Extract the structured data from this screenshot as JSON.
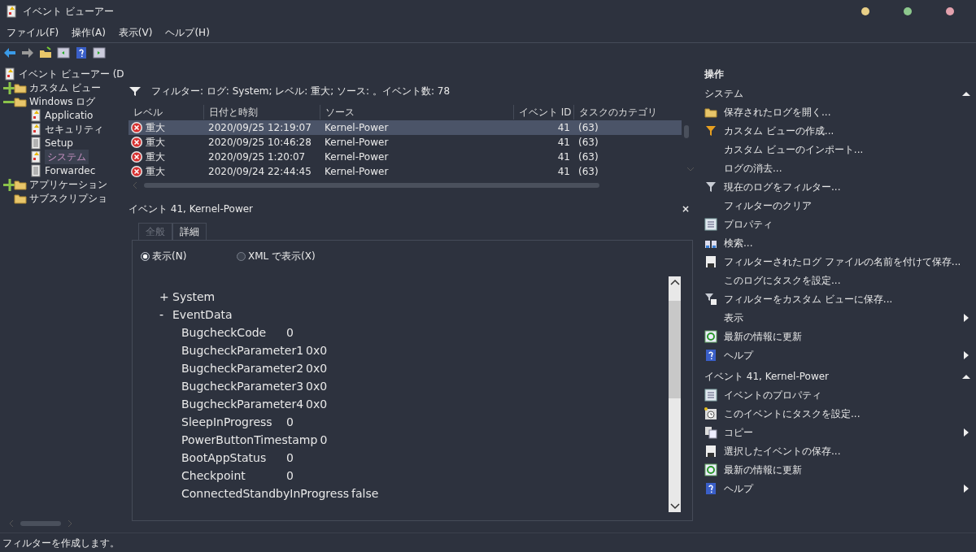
{
  "window": {
    "title": "イベント ビューアー"
  },
  "menu": [
    "ファイル(F)",
    "操作(A)",
    "表示(V)",
    "ヘルプ(H)"
  ],
  "tree": [
    {
      "label": "イベント ビューアー (D",
      "kind": "log",
      "selected": false,
      "children": [
        {
          "label": "カスタム ビュー",
          "kind": "folder",
          "expanded": false,
          "selected": false
        },
        {
          "label": "Windows ログ",
          "kind": "folder",
          "expanded": true,
          "selected": false,
          "children": [
            {
              "label": "Applicatio",
              "kind": "log",
              "selected": false
            },
            {
              "label": "セキュリティ",
              "kind": "log",
              "selected": false
            },
            {
              "label": "Setup",
              "kind": "doc",
              "selected": false
            },
            {
              "label": "システム",
              "kind": "log",
              "selected": true
            },
            {
              "label": "Forwardec",
              "kind": "doc",
              "selected": false
            }
          ]
        },
        {
          "label": "アプリケーション",
          "kind": "folder",
          "expanded": false,
          "selected": false
        },
        {
          "label": "サブスクリプショ",
          "kind": "folder",
          "selected": false
        }
      ]
    }
  ],
  "filter_text": "フィルター: ログ: System; レベル: 重大; ソース: 。イベント数: 78",
  "table": {
    "columns": [
      "レベル",
      "日付と時刻",
      "ソース",
      "イベント ID",
      "タスクのカテゴリ"
    ],
    "rows": [
      {
        "level": "重大",
        "date": "2020/09/25 12:19:07",
        "source": "Kernel-Power",
        "event_id": "41",
        "category": "(63)",
        "selected": true
      },
      {
        "level": "重大",
        "date": "2020/09/25 10:46:28",
        "source": "Kernel-Power",
        "event_id": "41",
        "category": "(63)",
        "selected": false
      },
      {
        "level": "重大",
        "date": "2020/09/25 1:20:07",
        "source": "Kernel-Power",
        "event_id": "41",
        "category": "(63)",
        "selected": false
      },
      {
        "level": "重大",
        "date": "2020/09/24 22:44:45",
        "source": "Kernel-Power",
        "event_id": "41",
        "category": "(63)",
        "selected": false
      }
    ]
  },
  "detail": {
    "title": "イベント 41, Kernel-Power",
    "close": "×",
    "tabs": [
      {
        "label": "全般",
        "selected": false
      },
      {
        "label": "詳細",
        "selected": true
      }
    ],
    "view_options": [
      {
        "label": "表示(N)",
        "selected": true
      },
      {
        "label": "XML で表示(X)",
        "selected": false
      }
    ],
    "nodes": [
      {
        "toggle": "+",
        "label": "System",
        "expanded": false
      },
      {
        "toggle": "-",
        "label": "EventData",
        "expanded": true,
        "fields": [
          {
            "name": "BugcheckCode",
            "value": "0"
          },
          {
            "name": "BugcheckParameter1",
            "value": "0x0"
          },
          {
            "name": "BugcheckParameter2",
            "value": "0x0"
          },
          {
            "name": "BugcheckParameter3",
            "value": "0x0"
          },
          {
            "name": "BugcheckParameter4",
            "value": "0x0"
          },
          {
            "name": "SleepInProgress",
            "value": "0"
          },
          {
            "name": "PowerButtonTimestamp",
            "value": "0"
          },
          {
            "name": "BootAppStatus",
            "value": "0"
          },
          {
            "name": "Checkpoint",
            "value": "0"
          },
          {
            "name": "ConnectedStandbyInProgress",
            "value": "false"
          }
        ]
      }
    ]
  },
  "actions": {
    "title": "操作",
    "sections": [
      {
        "title": "システム",
        "expanded": true,
        "items": [
          {
            "label": "保存されたログを開く...",
            "kind": "folder",
            "submenu": false
          },
          {
            "label": "カスタム ビューの作成...",
            "kind": "filter-orange",
            "submenu": false
          },
          {
            "label": "カスタム ビューのインポート...",
            "kind": "plain",
            "submenu": false
          },
          {
            "label": "ログの消去...",
            "kind": "plain",
            "submenu": false
          },
          {
            "label": "現在のログをフィルター...",
            "kind": "filter",
            "submenu": false
          },
          {
            "label": "フィルターのクリア",
            "kind": "plain",
            "submenu": false
          },
          {
            "label": "プロパティ",
            "kind": "props",
            "submenu": false
          },
          {
            "label": "検索...",
            "kind": "binoculars",
            "submenu": false
          },
          {
            "label": "フィルターされたログ ファイルの名前を付けて保存...",
            "kind": "save",
            "submenu": false
          },
          {
            "label": "このログにタスクを設定...",
            "kind": "plain",
            "submenu": false
          },
          {
            "label": "フィルターをカスタム ビューに保存...",
            "kind": "filter-save",
            "submenu": false
          },
          {
            "label": "表示",
            "kind": "plain",
            "submenu": true
          },
          {
            "label": "最新の情報に更新",
            "kind": "refresh",
            "submenu": false
          },
          {
            "label": "ヘルプ",
            "kind": "help",
            "submenu": true
          }
        ]
      },
      {
        "title": "イベント 41, Kernel-Power",
        "expanded": true,
        "items": [
          {
            "label": "イベントのプロパティ",
            "kind": "props",
            "submenu": false
          },
          {
            "label": "このイベントにタスクを設定...",
            "kind": "task",
            "submenu": false
          },
          {
            "label": "コピー",
            "kind": "copy",
            "submenu": true
          },
          {
            "label": "選択したイベントの保存...",
            "kind": "save",
            "submenu": false
          },
          {
            "label": "最新の情報に更新",
            "kind": "refresh",
            "submenu": false
          },
          {
            "label": "ヘルプ",
            "kind": "help",
            "submenu": true
          }
        ]
      }
    ]
  },
  "status_bar": "フィルターを作成します。"
}
